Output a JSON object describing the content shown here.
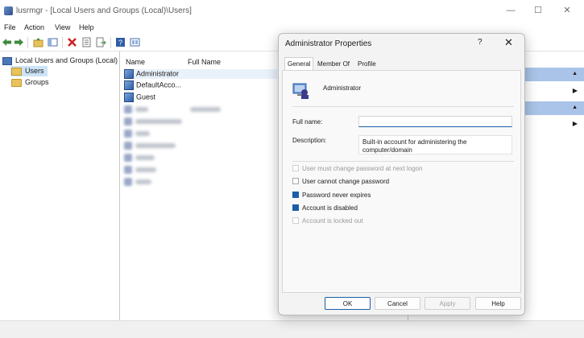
{
  "window": {
    "title": "lusrmgr - [Local Users and Groups (Local)\\Users]",
    "controls": {
      "minimize": "—",
      "maximize": "☐",
      "close": "✕"
    }
  },
  "menu": {
    "items": [
      "File",
      "Action",
      "View",
      "Help"
    ]
  },
  "toolbar": {
    "icons": [
      "back-arrow-icon",
      "forward-arrow-icon",
      "up-folder-icon",
      "show-hide-tree-icon",
      "delete-icon",
      "properties-icon",
      "export-list-icon",
      "help-icon",
      "view-icon"
    ]
  },
  "tree": {
    "root": "Local Users and Groups (Local)",
    "items": [
      "Users",
      "Groups"
    ],
    "selected": "Users"
  },
  "list": {
    "columns": {
      "name": "Name",
      "full_name": "Full Name"
    },
    "rows": [
      {
        "name": "Administrator"
      },
      {
        "name": "DefaultAcco..."
      },
      {
        "name": "Guest"
      }
    ]
  },
  "dialog": {
    "title": "Administrator Properties",
    "help": "?",
    "close": "✕",
    "tabs": [
      "General",
      "Member Of",
      "Profile"
    ],
    "active_tab": "General",
    "user_name": "Administrator",
    "full_name_label": "Full name:",
    "full_name_value": "",
    "description_label": "Description:",
    "description_value": "Built-in account for administering the computer/domain",
    "checkboxes": [
      {
        "label": "User must change password at next logon",
        "checked": false,
        "disabled": true
      },
      {
        "label": "User cannot change password",
        "checked": false,
        "disabled": false
      },
      {
        "label": "Password never expires",
        "checked": true,
        "disabled": false
      },
      {
        "label": "Account is disabled",
        "checked": true,
        "disabled": false
      },
      {
        "label": "Account is locked out",
        "checked": false,
        "disabled": true
      }
    ],
    "buttons": {
      "ok": "OK",
      "cancel": "Cancel",
      "apply": "Apply",
      "help": "Help"
    }
  },
  "colors": {
    "accent": "#1b5ea8",
    "selection": "#cce4f7",
    "action_header": "#a9c4e8"
  }
}
